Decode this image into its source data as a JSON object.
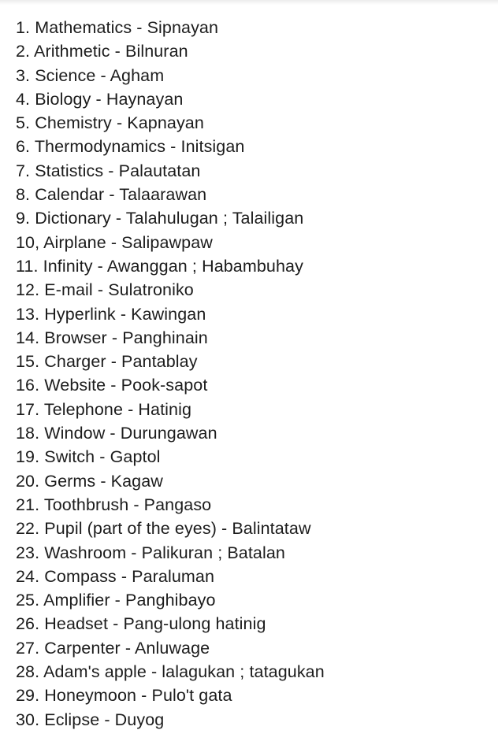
{
  "items": [
    {
      "text": "1. Mathematics - Sipnayan"
    },
    {
      "text": "2. Arithmetic - Bilnuran"
    },
    {
      "text": "3. Science - Agham"
    },
    {
      "text": "4. Biology - Haynayan"
    },
    {
      "text": "5. Chemistry - Kapnayan"
    },
    {
      "text": "6. Thermodynamics - Initsigan"
    },
    {
      "text": "7. Statistics - Palautatan"
    },
    {
      "text": "8. Calendar - Talaarawan"
    },
    {
      "text": "9. Dictionary - Talahulugan ; Talailigan"
    },
    {
      "text": "10, Airplane - Salipawpaw"
    },
    {
      "text": "11. Infinity - Awanggan ; Habambuhay"
    },
    {
      "text": "12. E-mail - Sulatroniko"
    },
    {
      "text": "13. Hyperlink - Kawingan"
    },
    {
      "text": "14. Browser - Panghinain"
    },
    {
      "text": "15. Charger - Pantablay"
    },
    {
      "text": "16. Website - Pook-sapot"
    },
    {
      "text": "17. Telephone - Hatinig"
    },
    {
      "text": "18. Window - Durungawan"
    },
    {
      "text": "19. Switch - Gaptol"
    },
    {
      "text": "20. Germs - Kagaw"
    },
    {
      "text": "21. Toothbrush - Pangaso"
    },
    {
      "text": "22. Pupil (part of the eyes) - Balintataw"
    },
    {
      "text": "23. Washroom - Palikuran ; Batalan"
    },
    {
      "text": "24. Compass - Paraluman"
    },
    {
      "text": "25. Amplifier - Panghibayo"
    },
    {
      "text": "26. Headset - Pang-ulong hatinig"
    },
    {
      "text": "27. Carpenter - Anluwage"
    },
    {
      "text": "28. Adam's apple - lalagukan ; tatagukan"
    },
    {
      "text": "29. Honeymoon - Pulo't gata"
    },
    {
      "text": "30. Eclipse - Duyog"
    }
  ]
}
